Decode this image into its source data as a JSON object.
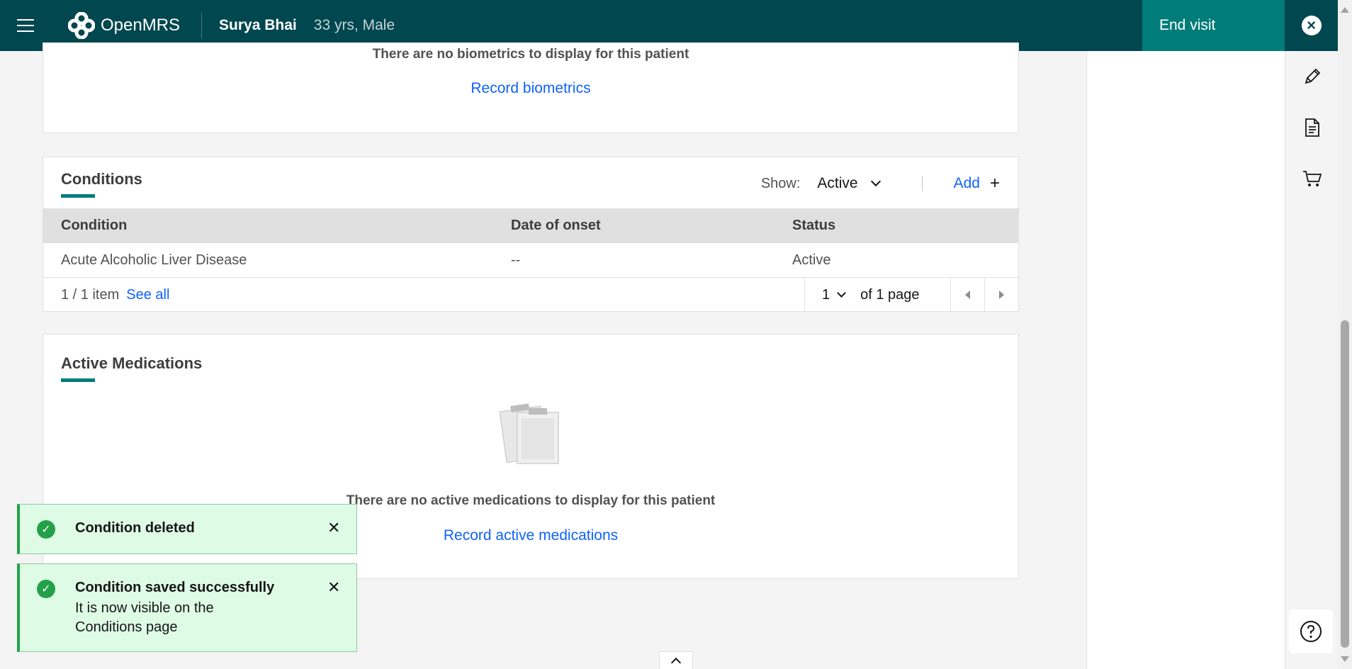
{
  "header": {
    "app_name": "OpenMRS",
    "patient_name": "Surya Bhai",
    "patient_meta": "33 yrs, Male",
    "end_visit_label": "End visit"
  },
  "biometrics": {
    "empty_text": "There are no biometrics to display for this patient",
    "record_link": "Record biometrics"
  },
  "conditions": {
    "title": "Conditions",
    "show_label": "Show:",
    "show_value": "Active",
    "add_label": "Add",
    "columns": [
      "Condition",
      "Date of onset",
      "Status"
    ],
    "rows": [
      {
        "condition": "Acute Alcoholic Liver Disease",
        "onset": "--",
        "status": "Active"
      }
    ],
    "pager": {
      "count": "1 / 1 item",
      "see_all": "See all",
      "page": "1",
      "of_pages": "of 1 page"
    }
  },
  "medications": {
    "title": "Active Medications",
    "empty_text": "There are no active medications to display for this patient",
    "record_link": "Record active medications"
  },
  "toasts": [
    {
      "title": "Condition deleted",
      "subtitle": ""
    },
    {
      "title": "Condition saved successfully",
      "subtitle": "It is now visible on the Conditions page"
    }
  ],
  "icons": {
    "menu": "hamburger-icon",
    "close": "close-icon",
    "pen": "pen-icon",
    "document": "document-icon",
    "cart": "cart-icon",
    "help": "help-icon",
    "success": "checkmark-filled-icon"
  },
  "colors": {
    "header_bg": "#00474f",
    "accent": "#007d79",
    "link": "#0f62fe",
    "toast_bg": "#defbe6",
    "success": "#24a148"
  }
}
